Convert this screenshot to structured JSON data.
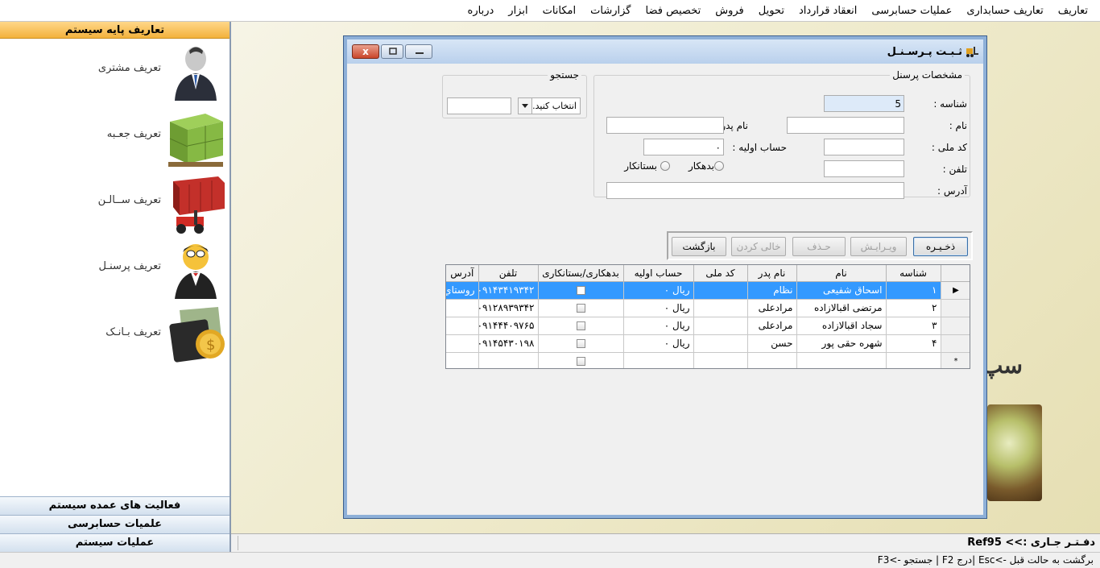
{
  "menu": [
    "تعاریف",
    "تعاریف حسابداری",
    "عملیات حسابرسی",
    "انعقاد قرارداد",
    "تحویل",
    "فروش",
    "تخصیص فضا",
    "گزارشات",
    "امکانات",
    "ابزار",
    "درباره"
  ],
  "sidebar": {
    "header": "تعاریف پایه سیستم",
    "items": [
      {
        "label": "تعریف مشتری",
        "icon": "customer-icon"
      },
      {
        "label": "تعریف جعـبه",
        "icon": "boxes-icon"
      },
      {
        "label": "تعریف ســالـن",
        "icon": "container-forklift-icon"
      },
      {
        "label": "تعریف پرسنـل",
        "icon": "personnel-icon"
      },
      {
        "label": "تعریف بـانـک",
        "icon": "bank-wallet-icon"
      }
    ],
    "bottom": [
      "فعالیت های عمده سیستم",
      "علمیات حسابرسی",
      "عملیات سیستم"
    ]
  },
  "background": {
    "brand_text": "سپ"
  },
  "status": {
    "current_label": "دفـتـر جـاری :>>",
    "current_value": "Ref95"
  },
  "hint": "برگشت به حالت قبل ->Esc |درج F2 | جستجو ->F3",
  "dialog": {
    "title": "ثـبـت پـرسـنـل",
    "close_label": "x",
    "specs_title": "مشخصات پرسنل",
    "search_title": "جستجو",
    "search_combo": "انتخاب کنید...",
    "search_value": "",
    "fields": {
      "id_label": "شناسه :",
      "id_value": "5",
      "name_label": "نام :",
      "name_value": "",
      "father_label": "نام پدر :",
      "father_value": "",
      "national_label": "کد ملی :",
      "national_value": "",
      "initial_label": "حساب اولیه :",
      "initial_value": "۰",
      "phone_label": "تلفن :",
      "phone_value": "",
      "debtor_label": "بدهکار",
      "creditor_label": "بستانکار",
      "address_label": "آدرس :",
      "address_value": ""
    },
    "buttons": {
      "save": "ذخـیـره",
      "edit": "ویـرایـش",
      "delete": "حـذف",
      "clear": "خالی کردن",
      "back": "بازگشت"
    },
    "grid": {
      "columns": [
        "شناسه",
        "نام",
        "نام پدر",
        "کد ملی",
        "حساب اولیه",
        "بدهکاری/بستانکاری",
        "تلفن",
        "آدرس"
      ],
      "rows": [
        {
          "id": "۱",
          "name": "اسحاق  شفیعی",
          "father": "نظام",
          "national": "",
          "initial": "ریال ۰",
          "flag": false,
          "phone": "۰۹۱۴۳۴۱۹۳۴۲",
          "address": "روستاي بالو"
        },
        {
          "id": "۲",
          "name": "مرتضی  اقبالازاده",
          "father": "مرادعلی",
          "national": "",
          "initial": "ریال ۰",
          "flag": false,
          "phone": "۰۹۱۲۸۹۳۹۳۴۲",
          "address": ""
        },
        {
          "id": "۳",
          "name": "سجاد اقبالازاده",
          "father": "مرادعلی",
          "national": "",
          "initial": "ریال ۰",
          "flag": false,
          "phone": "۰۹۱۴۴۴۰۹۷۶۵",
          "address": ""
        },
        {
          "id": "۴",
          "name": "شهره حقی پور",
          "father": "حسن",
          "national": "",
          "initial": "ریال ۰",
          "flag": false,
          "phone": "۰۹۱۴۵۴۳۰۱۹۸",
          "address": ""
        }
      ],
      "new_row_marker": "*",
      "current_row_marker": "▶"
    }
  }
}
